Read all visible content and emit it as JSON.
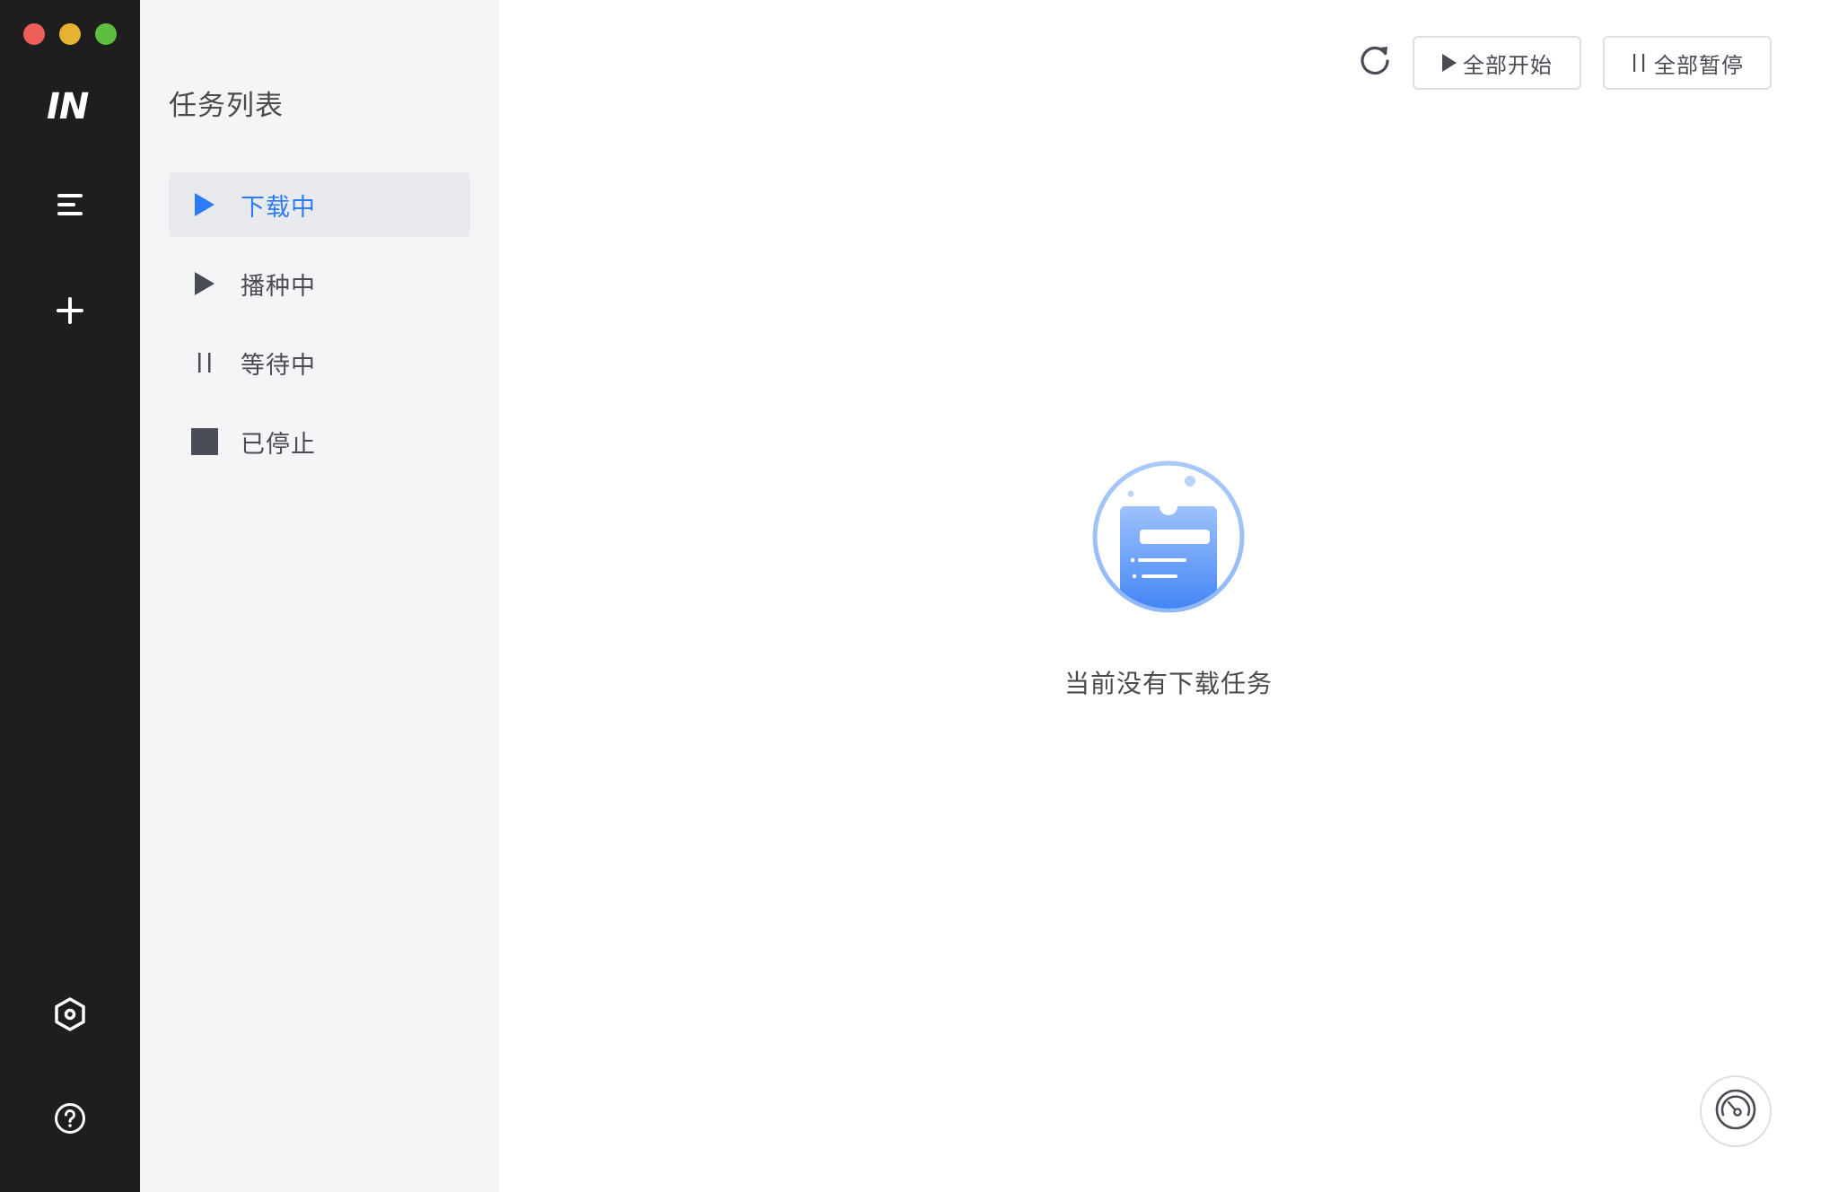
{
  "sidebar_rail": {
    "logo_text": "IN",
    "icons": [
      "menu-icon",
      "plus-icon",
      "settings-hex-icon",
      "help-icon"
    ]
  },
  "task_panel": {
    "title": "任务列表",
    "items": [
      {
        "label": "下载中",
        "icon": "play-icon",
        "active": true
      },
      {
        "label": "播种中",
        "icon": "play-icon",
        "active": false
      },
      {
        "label": "等待中",
        "icon": "pause-icon",
        "active": false
      },
      {
        "label": "已停止",
        "icon": "stop-icon",
        "active": false
      }
    ]
  },
  "toolbar": {
    "refresh_icon": "refresh-icon",
    "start_all_label": "全部开始",
    "pause_all_label": "全部暂停"
  },
  "empty_state": {
    "message": "当前没有下载任务"
  },
  "colors": {
    "accent": "#2d7cf7",
    "rail_bg": "#1e1e1e",
    "panel_bg": "#f4f5f7"
  }
}
